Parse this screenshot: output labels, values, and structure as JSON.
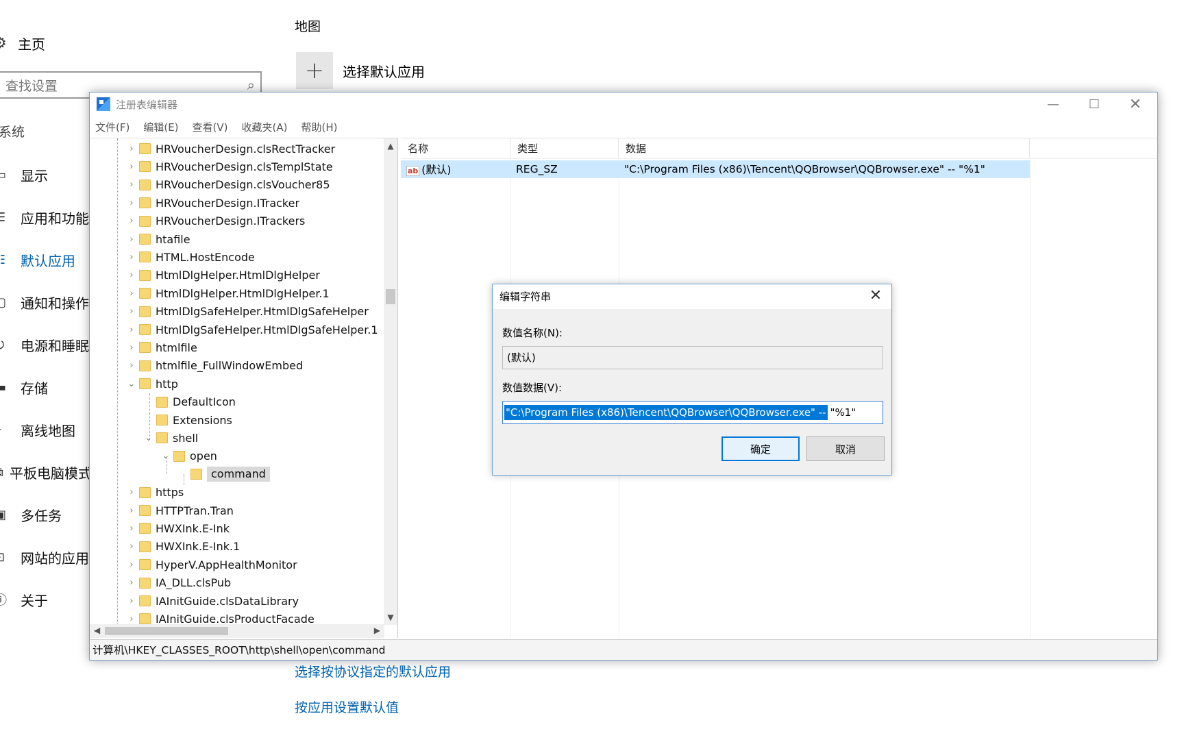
{
  "settings": {
    "home_label": "主页",
    "search_placeholder": "查找设置",
    "section_label": "系统",
    "nav_items": [
      {
        "label": "显示",
        "icon": "monitor-icon"
      },
      {
        "label": "应用和功能",
        "icon": "apps-list-icon"
      },
      {
        "label": "默认应用",
        "icon": "default-apps-icon",
        "active": true
      },
      {
        "label": "通知和操作",
        "icon": "notification-icon"
      },
      {
        "label": "电源和睡眠",
        "icon": "power-icon"
      },
      {
        "label": "存储",
        "icon": "storage-icon"
      },
      {
        "label": "离线地图",
        "icon": "map-icon"
      },
      {
        "label": "平板电脑模式",
        "icon": "tablet-icon"
      },
      {
        "label": "多任务",
        "icon": "multitask-icon"
      },
      {
        "label": "网站的应用",
        "icon": "web-apps-icon"
      },
      {
        "label": "关于",
        "icon": "info-icon"
      }
    ],
    "main": {
      "map_title": "地图",
      "choose_default_label": "选择默认应用",
      "link_protocol": "选择按协议指定的默认应用",
      "link_by_app": "按应用设置默认值"
    },
    "accent_color": "#0063b1"
  },
  "regedit": {
    "title": "注册表编辑器",
    "menu": [
      "文件(F)",
      "编辑(E)",
      "查看(V)",
      "收藏夹(A)",
      "帮助(H)"
    ],
    "tree": [
      {
        "label": "HRVoucherDesign.clsRectTracker",
        "level": 0,
        "state": "collapsed"
      },
      {
        "label": "HRVoucherDesign.clsTemplState",
        "level": 0,
        "state": "collapsed"
      },
      {
        "label": "HRVoucherDesign.clsVoucher85",
        "level": 0,
        "state": "collapsed"
      },
      {
        "label": "HRVoucherDesign.ITracker",
        "level": 0,
        "state": "collapsed"
      },
      {
        "label": "HRVoucherDesign.ITrackers",
        "level": 0,
        "state": "collapsed"
      },
      {
        "label": "htafile",
        "level": 0,
        "state": "collapsed"
      },
      {
        "label": "HTML.HostEncode",
        "level": 0,
        "state": "collapsed"
      },
      {
        "label": "HtmlDlgHelper.HtmlDlgHelper",
        "level": 0,
        "state": "collapsed"
      },
      {
        "label": "HtmlDlgHelper.HtmlDlgHelper.1",
        "level": 0,
        "state": "collapsed"
      },
      {
        "label": "HtmlDlgSafeHelper.HtmlDlgSafeHelper",
        "level": 0,
        "state": "collapsed"
      },
      {
        "label": "HtmlDlgSafeHelper.HtmlDlgSafeHelper.1",
        "level": 0,
        "state": "collapsed"
      },
      {
        "label": "htmlfile",
        "level": 0,
        "state": "collapsed"
      },
      {
        "label": "htmlfile_FullWindowEmbed",
        "level": 0,
        "state": "collapsed"
      },
      {
        "label": "http",
        "level": 0,
        "state": "expanded"
      },
      {
        "label": "DefaultIcon",
        "level": 1,
        "state": "leaf"
      },
      {
        "label": "Extensions",
        "level": 1,
        "state": "leaf"
      },
      {
        "label": "shell",
        "level": 1,
        "state": "expanded"
      },
      {
        "label": "open",
        "level": 2,
        "state": "expanded"
      },
      {
        "label": "command",
        "level": 3,
        "state": "leaf",
        "selected": true
      },
      {
        "label": "https",
        "level": 0,
        "state": "collapsed"
      },
      {
        "label": "HTTPTran.Tran",
        "level": 0,
        "state": "collapsed"
      },
      {
        "label": "HWXInk.E-Ink",
        "level": 0,
        "state": "collapsed"
      },
      {
        "label": "HWXInk.E-Ink.1",
        "level": 0,
        "state": "collapsed"
      },
      {
        "label": "HyperV.AppHealthMonitor",
        "level": 0,
        "state": "collapsed"
      },
      {
        "label": "IA_DLL.clsPub",
        "level": 0,
        "state": "collapsed"
      },
      {
        "label": "IAInitGuide.clsDataLibrary",
        "level": 0,
        "state": "collapsed"
      },
      {
        "label": "IAInitGuide.clsProductFacade",
        "level": 0,
        "state": "collapsed"
      }
    ],
    "list": {
      "headers": {
        "name": "名称",
        "type": "类型",
        "data": "数据"
      },
      "rows": [
        {
          "name": "(默认)",
          "type": "REG_SZ",
          "data": "\"C:\\Program Files (x86)\\Tencent\\QQBrowser\\QQBrowser.exe\" -- \"%1\""
        }
      ]
    },
    "status_path": "计算机\\HKEY_CLASSES_ROOT\\http\\shell\\open\\command"
  },
  "dialog": {
    "title": "编辑字符串",
    "name_label": "数值名称(N):",
    "name_value": "(默认)",
    "data_label": "数值数据(V):",
    "data_selected": "\"C:\\Program Files (x86)\\Tencent\\QQBrowser\\QQBrowser.exe\" --",
    "data_rest": "\"%1\"",
    "ok_label": "确定",
    "cancel_label": "取消"
  }
}
